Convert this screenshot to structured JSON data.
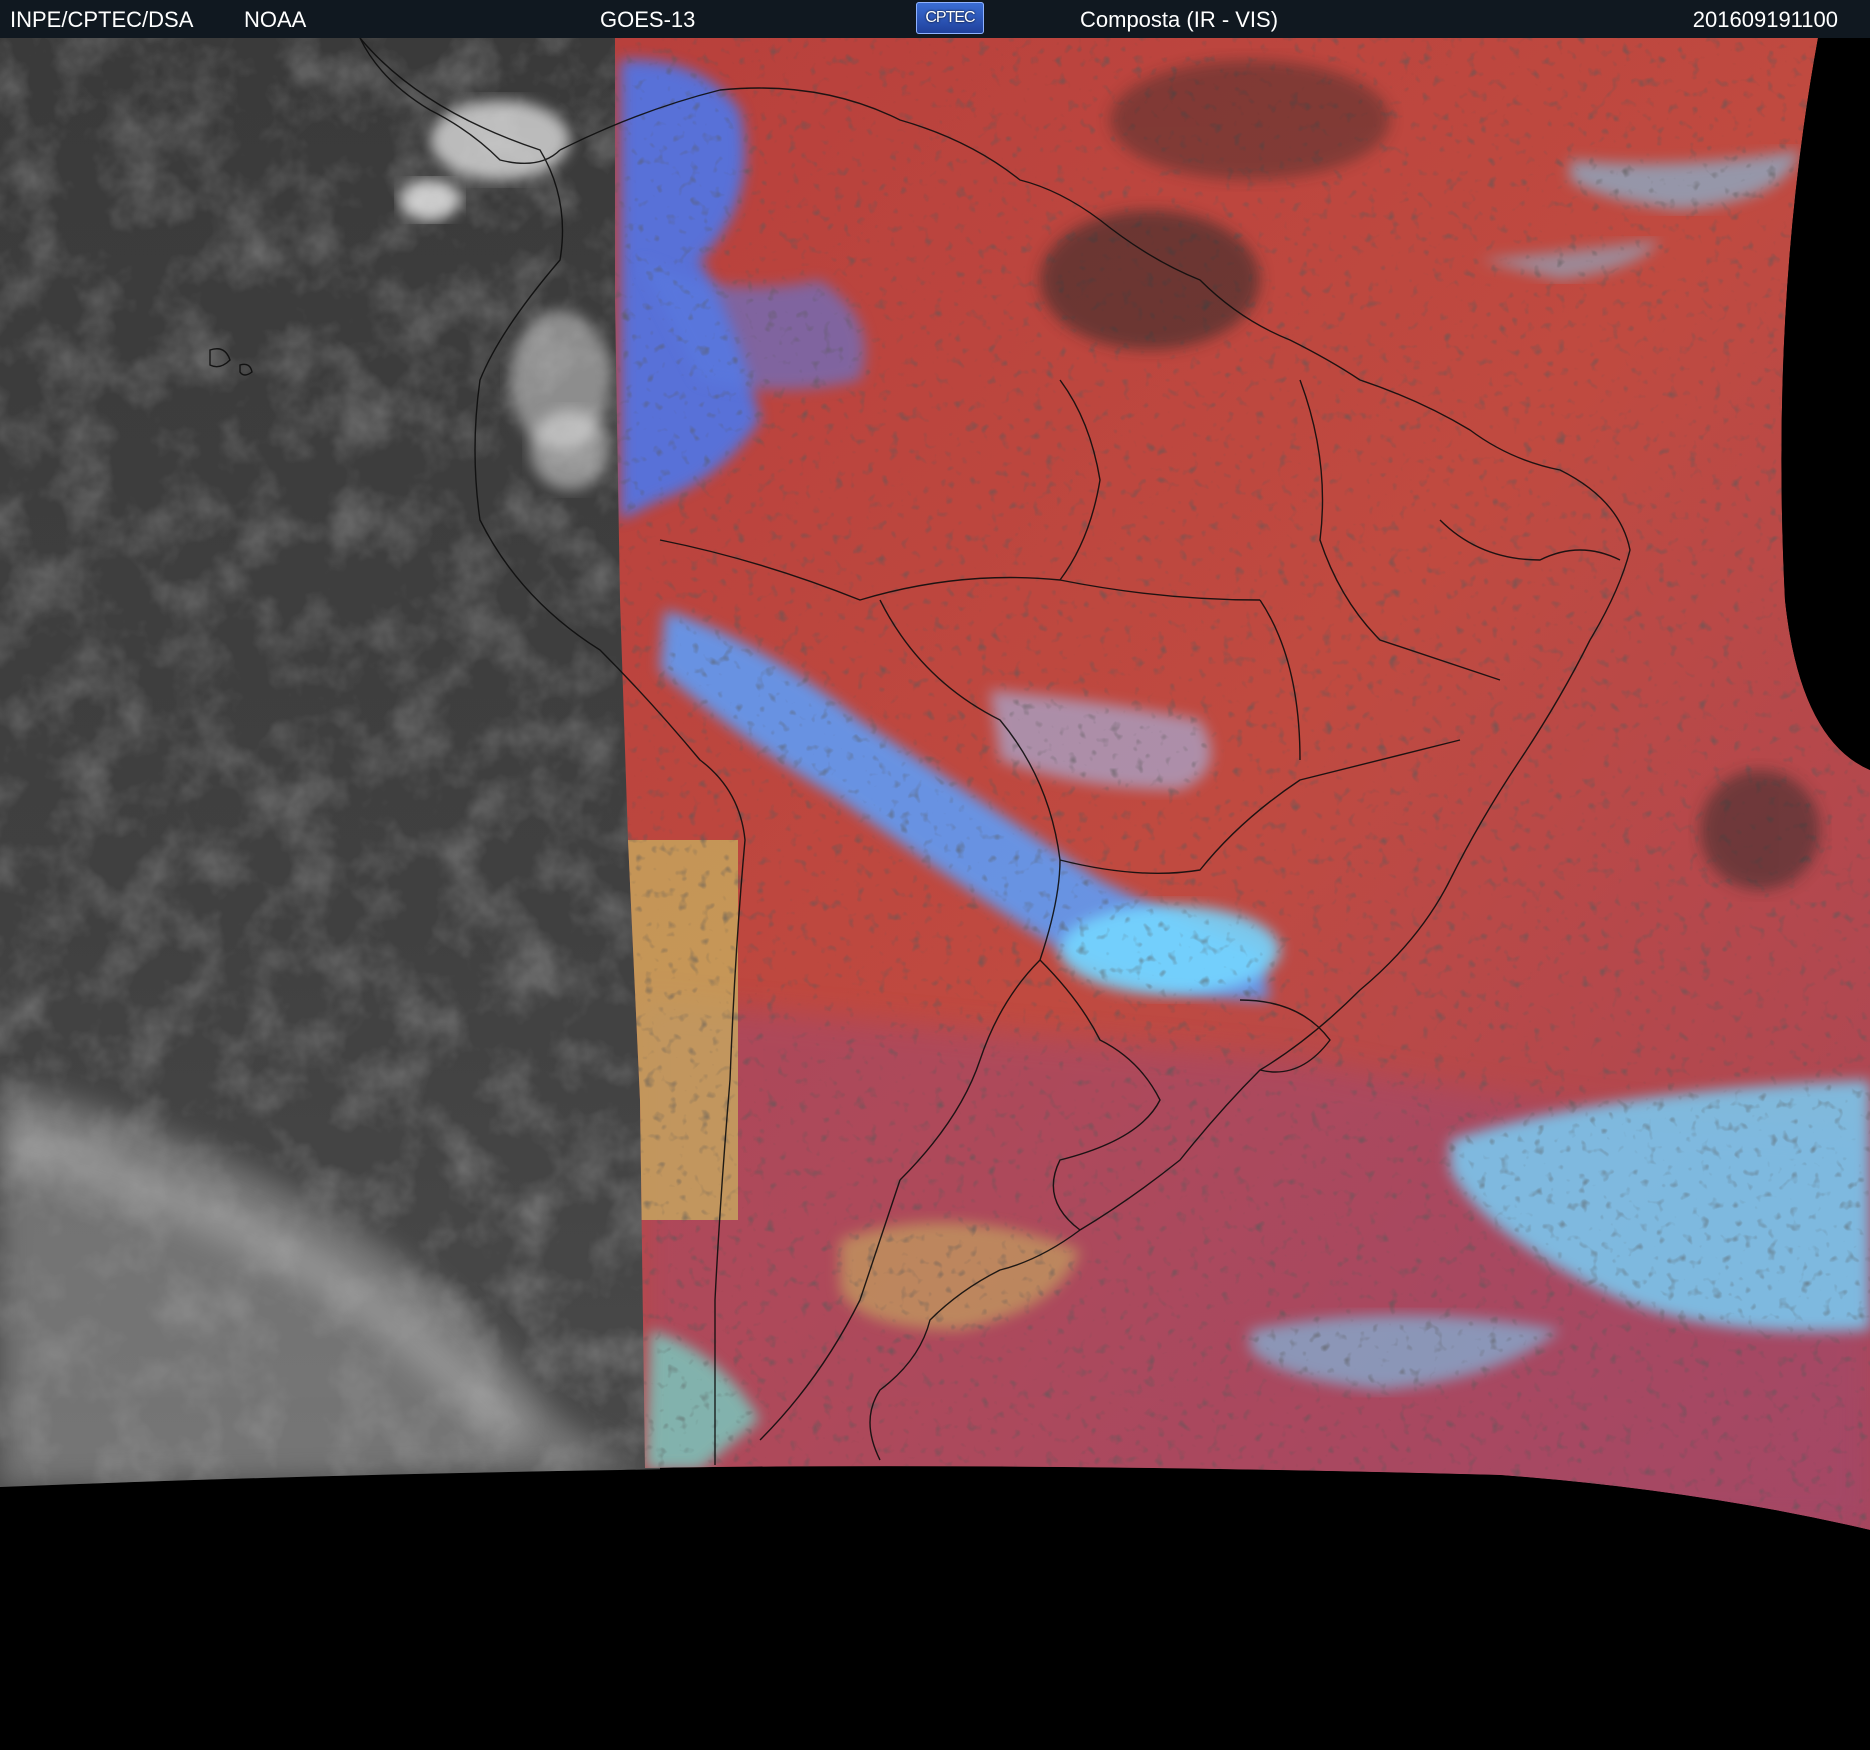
{
  "header": {
    "organization": "INPE/CPTEC/DSA",
    "agency": "NOAA",
    "satellite": "GOES-13",
    "logo_text": "CPTEC",
    "product": "Composta (IR - VIS)",
    "timestamp": "201609191100"
  },
  "colors": {
    "header_background": "#101820",
    "space": "#000000",
    "ir_region": "#3d3d3d",
    "composite_base": "#b84a44",
    "cloud_blue": "#3f7dff",
    "cloud_cyan": "#74d6ff",
    "land_yellow": "#c8b060"
  }
}
